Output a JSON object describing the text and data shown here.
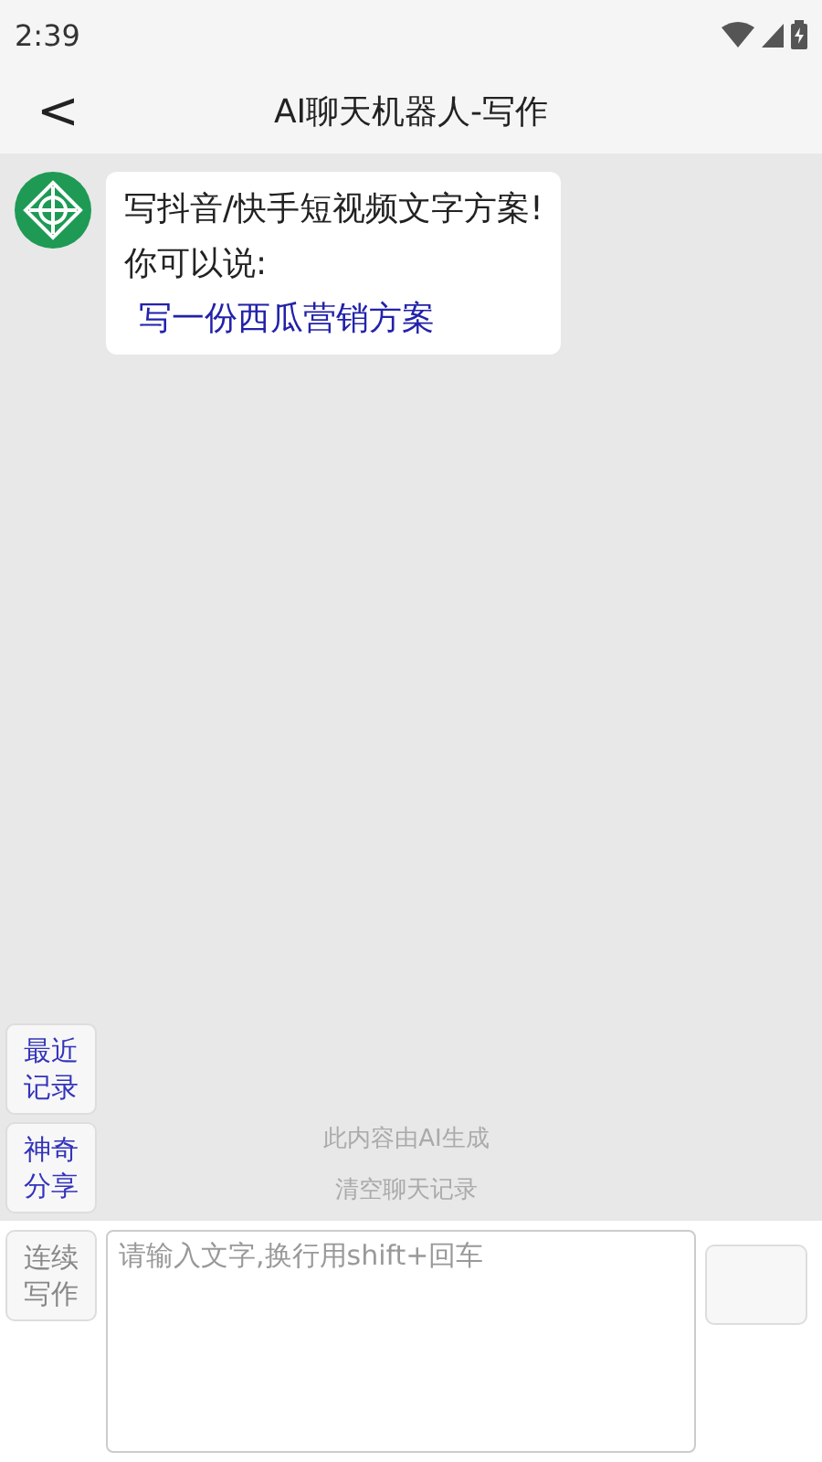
{
  "status_bar": {
    "time": "2:39"
  },
  "header": {
    "back": "<",
    "title": "AI聊天机器人-写作"
  },
  "messages": [
    {
      "lines": [
        "写抖音/快手短视频文字方案!",
        "你可以说:"
      ],
      "suggestion": "写一份西瓜营销方案"
    }
  ],
  "side_buttons": [
    {
      "label": "最近记录",
      "disabled": false
    },
    {
      "label": "神奇分享",
      "disabled": false
    }
  ],
  "notice": "此内容由AI生成",
  "clear": "清空聊天记录",
  "input_bar": {
    "mode_button": {
      "label": "连续写作",
      "disabled": true
    },
    "placeholder": "请输入文字,换行用shift+回车"
  }
}
